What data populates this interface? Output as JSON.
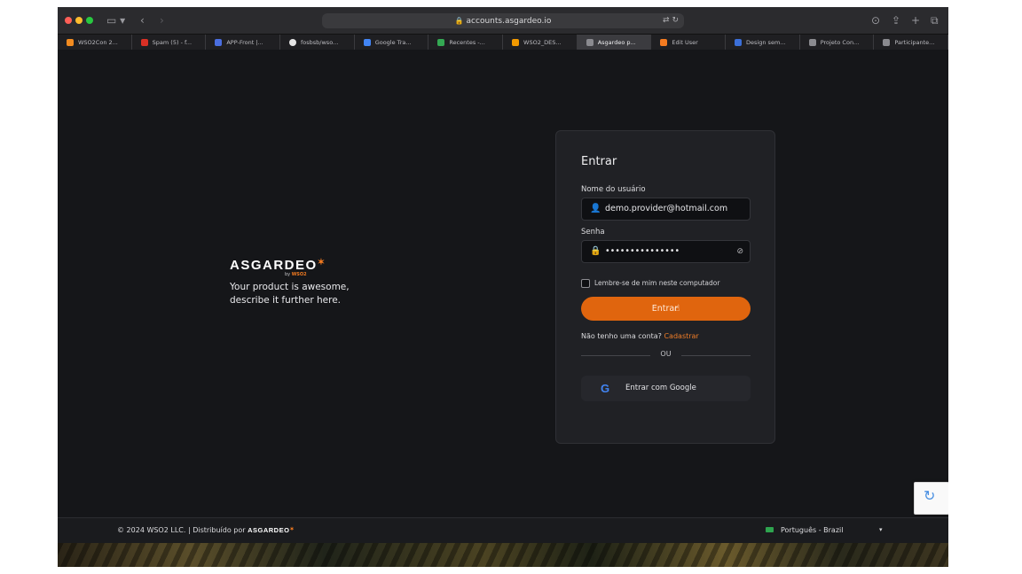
{
  "browser": {
    "url": "accounts.asgardeo.io",
    "tabs": [
      {
        "label": "WSO2Con 2...",
        "color": "#f28b20"
      },
      {
        "label": "Spam (5) - f...",
        "color": "#d93025"
      },
      {
        "label": "APP-Front |...",
        "color": "#4a6ee0"
      },
      {
        "label": "fosbsb/wso...",
        "color": "#e6e6e6"
      },
      {
        "label": "Google Tra...",
        "color": "#4285f4"
      },
      {
        "label": "Recentes -...",
        "color": "#34a853"
      },
      {
        "label": "WSO2_DES...",
        "color": "#f29900"
      },
      {
        "label": "Asgardeo p...",
        "color": "#8a8a8f"
      },
      {
        "label": "Edit User",
        "color": "#f47b20"
      },
      {
        "label": "Design sem...",
        "color": "#3b6fd8"
      },
      {
        "label": "Projeto Con...",
        "color": "#8a8a8f"
      },
      {
        "label": "Participante...",
        "color": "#8a8a8f"
      }
    ]
  },
  "brand": {
    "logo": "ASGARDEO",
    "by": "by",
    "by_brand": "WSO2",
    "tagline": "Your product is awesome, describe it further here."
  },
  "login": {
    "title": "Entrar",
    "username_label": "Nome do usuário",
    "username_value": "demo.provider@hotmail.com",
    "password_label": "Senha",
    "password_value": "•••••••••••••••",
    "remember_label": "Lembre-se de mim neste computador",
    "submit_label": "Entrar",
    "no_account_text": "Não tenho uma conta?",
    "register_link": "Cadastrar",
    "or_text": "OU",
    "google_label": "Entrar com Google"
  },
  "footer": {
    "copyright": "© 2024 WSO2 LLC. | Distribuído por",
    "footer_logo": "ASGARDEO",
    "language": "Português - Brazil"
  },
  "colors": {
    "accent": "#e0650e",
    "background": "#151619",
    "card": "#202125"
  },
  "icons": [
    "sidebar-icon",
    "back-icon",
    "forward-icon",
    "lock-icon",
    "translate-icon",
    "reload-icon",
    "download-icon",
    "share-icon",
    "new-tab-icon",
    "tabs-overview-icon",
    "user-icon",
    "password-lock-icon",
    "eye-off-icon",
    "google-icon",
    "recaptcha-icon",
    "flag-icon",
    "caret-down-icon"
  ]
}
